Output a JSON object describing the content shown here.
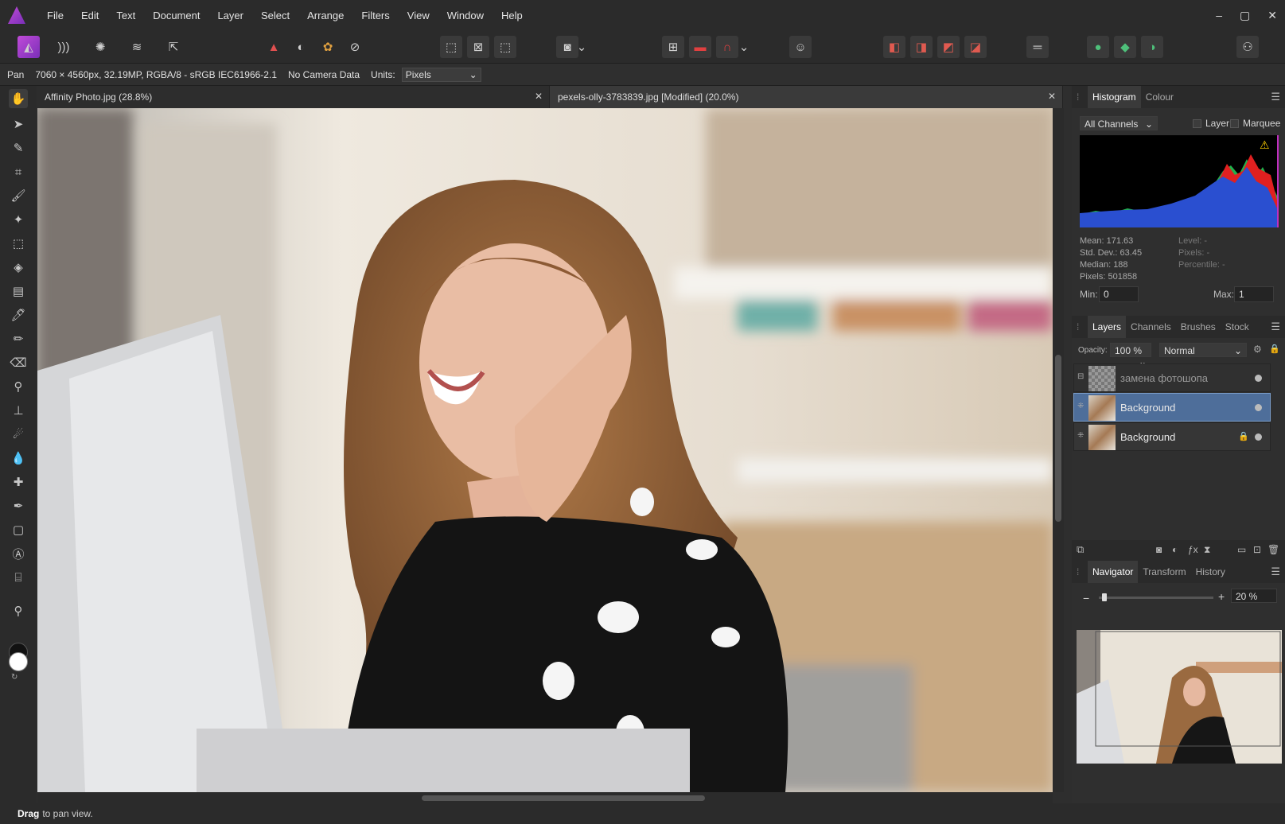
{
  "menu": [
    "File",
    "Edit",
    "Text",
    "Document",
    "Layer",
    "Select",
    "Arrange",
    "Filters",
    "View",
    "Window",
    "Help"
  ],
  "window_controls": {
    "minimize": "–",
    "maximize": "▢",
    "close": "✕"
  },
  "context_bar": {
    "tool": "Pan",
    "doc_info": "7060 × 4560px, 32.19MP, RGBA/8 - sRGB IEC61966-2.1",
    "camera": "No Camera Data",
    "units_label": "Units:",
    "units_value": "Pixels"
  },
  "tabs": [
    {
      "label": "Affinity Photo.jpg (28.8%)",
      "close": "✕"
    },
    {
      "label": "pexels-olly-3783839.jpg [Modified] (20.0%)",
      "close": "✕"
    }
  ],
  "histogram": {
    "tabs": [
      "Histogram",
      "Colour"
    ],
    "channel": "All Channels",
    "layer_label": "Layer",
    "marquee_label": "Marquee",
    "stats_left": [
      "Mean: 171.63",
      "Std. Dev.: 63.45",
      "Median: 188",
      "Pixels: 501858"
    ],
    "stats_right": [
      "Level: -",
      "Pixels: -",
      "Percentile: -"
    ],
    "min_label": "Min:",
    "min_value": "0",
    "max_label": "Max:",
    "max_value": "1"
  },
  "layers": {
    "tabs": [
      "Layers",
      "Channels",
      "Brushes",
      "Stock"
    ],
    "opacity_label": "Opacity:",
    "opacity_value": "100 %",
    "blend_mode": "Normal",
    "items": [
      {
        "name": "замена фотошопа",
        "locked": false,
        "selected": false
      },
      {
        "name": "Background",
        "locked": false,
        "selected": true
      },
      {
        "name": "Background",
        "locked": true,
        "selected": false
      }
    ]
  },
  "navigator": {
    "tabs": [
      "Navigator",
      "Transform",
      "History"
    ],
    "zoom_value": "20 %",
    "zoom_level": 0.03
  },
  "status": {
    "bold": "Drag",
    "text": "to pan view."
  }
}
